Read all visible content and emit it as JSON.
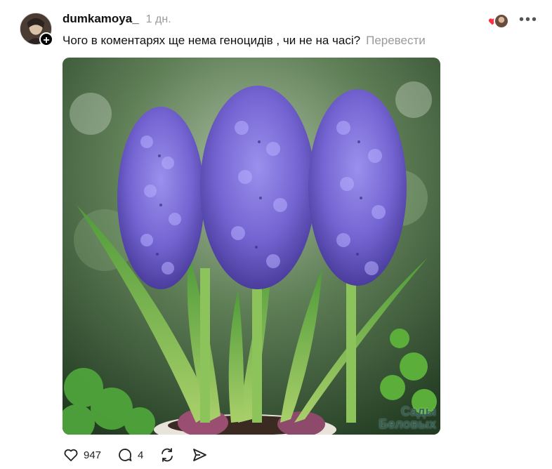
{
  "post": {
    "username": "dumkamoya_",
    "timestamp": "1 дн.",
    "text": "Чого в коментарях ще нема геноцидів , чи не на часі?",
    "translate_label": "Перевести",
    "follow_badge": "+",
    "more_label": "•••",
    "image": {
      "description_icon": "hyacinth-photo",
      "watermark_line1": "Сады",
      "watermark_line2": "Беловых"
    },
    "actions": {
      "likes_count": "947",
      "comments_count": "4"
    },
    "colors": {
      "heart_red": "#ff3040",
      "muted_text": "#9a9a9a",
      "flower_purple": "#7b6fd6"
    }
  }
}
